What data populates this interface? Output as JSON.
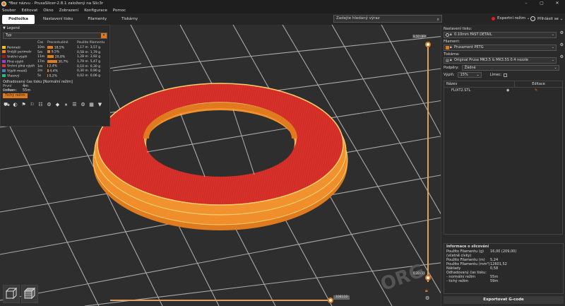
{
  "window": {
    "title": "*Bez názvu - PrusaSlicer-2.8.1 založený na Slic3r",
    "controls": [
      "–",
      "▢",
      "✕"
    ]
  },
  "menu": [
    "Soubor",
    "Editovat",
    "Okno",
    "Zobrazení",
    "Konfigurace",
    "Pomoc"
  ],
  "tabs": [
    "Podložka",
    "Nastavení tisku",
    "Filamenty",
    "Tiskárny"
  ],
  "search": {
    "placeholder": "Zadejte hledaný výraz"
  },
  "mode": {
    "label": "Expertní režim",
    "color": "#e0201c"
  },
  "login": {
    "label": "Přihlásit se"
  },
  "legend": {
    "header": "Legend",
    "type_value": "Typ",
    "columns": [
      "",
      "Čas",
      "Procentuálně",
      "Použito filamentu"
    ],
    "rows": [
      {
        "name": "Perimetr",
        "color": "#f2c31a",
        "time": "10m",
        "percent": "18,5%",
        "pct": 18.5,
        "len": "1,17 m",
        "weight": "3,57 g"
      },
      {
        "name": "Vnější perimetr",
        "color": "#f07d1a",
        "time": "5m",
        "percent": "9,5%",
        "pct": 9.5,
        "len": "0,58 m",
        "weight": "1,79 g"
      },
      {
        "name": "Vnitřní výplň",
        "color": "#a01a1a",
        "time": "11m",
        "percent": "20,8%",
        "pct": 20.8,
        "len": "1,28 m",
        "weight": "3,92 g"
      },
      {
        "name": "Plná výplň",
        "color": "#9a3fd1",
        "time": "17m",
        "percent": "30,7%",
        "pct": 30.7,
        "len": "1,79 m",
        "weight": "5,47 g"
      },
      {
        "name": "Vrchní plná výplň",
        "color": "#e03434",
        "time": "1m",
        "percent": "2,4%",
        "pct": 2.4,
        "len": "0,10 m",
        "weight": "0,30 g"
      },
      {
        "name": "Výplň mostů",
        "color": "#4d80ba",
        "time": "2m",
        "percent": "4,4%",
        "pct": 4.4,
        "len": "0,30 m",
        "weight": "0,90 g"
      },
      {
        "name": "Vlasový",
        "color": "#1fbf8c",
        "time": "5s",
        "percent": "0,2%",
        "pct": 0.2,
        "len": "0,02 m",
        "weight": "0,06 g"
      }
    ],
    "estimated_title": "Odhadovaný čas tisku [Normální režim]",
    "first_layer_label": "První vrstva:",
    "first_layer_value": "4m",
    "total_label": "Celkem:",
    "total_value": "55m",
    "silent_button": "Tichý režim"
  },
  "slider": {
    "top_label": "9,50 (89)",
    "bottom_label": "0,20 (1)",
    "horizontal_value": "108110"
  },
  "panel": {
    "print_settings_label": "Nastavení tisku:",
    "print_profile": "0.10mm FAST DETAIL",
    "filament_label": "Filament:",
    "filament_profile": "Prusament PETG",
    "filament_color": "#e07a1f",
    "printer_label": "Tiskárna:",
    "printer_profile": "Original Prusa MK3.5 & MK3.5S 0.4 nozzle",
    "supports_label": "Podpěry:",
    "supports_value": "Žádné",
    "infill_label": "Výplň:",
    "infill_value": "15%",
    "brim_label": "Límec:",
    "object_columns": [
      "Název",
      "Editace"
    ],
    "objects": [
      {
        "name": "FLIXT2.STL"
      }
    ]
  },
  "info": {
    "title": "Informace o slicování",
    "lines": [
      {
        "label": "Použito Filamentu (g)",
        "value": "16,00 (209,00)"
      },
      {
        "label": "(včetně cívky)",
        "value": ""
      },
      {
        "label": "Použito Filamentu (m)",
        "value": "5,24"
      },
      {
        "label": "Použito Filamentu (mm³)",
        "value": "12601,52"
      },
      {
        "label": "Náklady",
        "value": "0,58"
      },
      {
        "label": "Odhadovaný čas tisku:",
        "value": ""
      },
      {
        "label": "- normální režim",
        "value": "55m"
      },
      {
        "label": "- tichý režim",
        "value": "59m"
      }
    ],
    "export_button": "Exportovat G-code"
  }
}
